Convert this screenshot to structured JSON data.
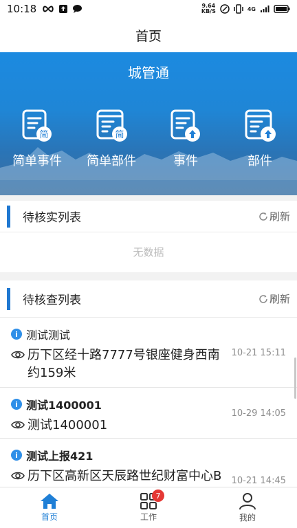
{
  "status_bar": {
    "time": "10:18",
    "net_speed_value": "9.64",
    "net_speed_unit": "KB/S",
    "network": "4G"
  },
  "header": {
    "title": "首页"
  },
  "banner": {
    "title": "城管通",
    "items": [
      {
        "label": "简单事件",
        "icon": "simple-event-icon",
        "glyph": "简"
      },
      {
        "label": "简单部件",
        "icon": "simple-part-icon",
        "glyph": "简"
      },
      {
        "label": "事件",
        "icon": "event-upload-icon"
      },
      {
        "label": "部件",
        "icon": "part-upload-icon"
      }
    ]
  },
  "pending_verify": {
    "title": "待核实列表",
    "refresh_label": "刷新",
    "empty_text": "无数据"
  },
  "pending_check": {
    "title": "待核查列表",
    "refresh_label": "刷新",
    "items": [
      {
        "title": "测试测试",
        "address": "历下区经十路7777号银座健身西南约159米",
        "date": "10-21 15:11"
      },
      {
        "title": "测试1400001",
        "address": "测试1400001",
        "date": "10-29 14:05"
      },
      {
        "title": "测试上报421",
        "address": "历下区高新区天辰路世纪财富中心B座济南新区龙湾",
        "date": "10-21 14:45"
      }
    ]
  },
  "bottom_nav": {
    "items": [
      {
        "label": "首页",
        "active": true
      },
      {
        "label": "工作",
        "badge": "7"
      },
      {
        "label": "我的"
      }
    ]
  },
  "colors": {
    "accent": "#1f7fd6",
    "badge": "#e53935",
    "info": "#2f8fe8"
  }
}
